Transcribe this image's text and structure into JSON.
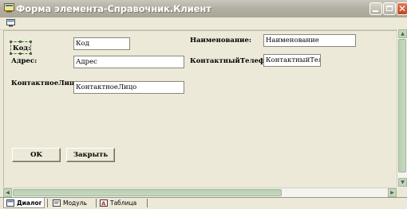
{
  "window": {
    "title": "Форма элемента-Справочник.Клиент"
  },
  "form": {
    "labels": {
      "code": "Код:",
      "address": "Адрес:",
      "contact_person": "КонтактноеЛицо:",
      "name": "Наименование:",
      "contact_phone": "КонтактныйТелефон"
    },
    "fields": {
      "code": "Код",
      "address": "Адрес",
      "contact_person": "КонтактноеЛицо",
      "name": "Наименование",
      "contact_phone": "КонтактныйТелеф"
    },
    "buttons": {
      "ok": "OK",
      "close": "Закрыть"
    }
  },
  "tabs": [
    {
      "label": "Диалог",
      "icon": "dialog-icon"
    },
    {
      "label": "Модуль",
      "icon": "module-icon"
    },
    {
      "label": "Таблица",
      "icon": "table-icon"
    }
  ],
  "colors": {
    "window_bg": "#ece9d8",
    "title_bar": "#b3b0a3",
    "scroll_thumb": "#c5d6bd"
  }
}
